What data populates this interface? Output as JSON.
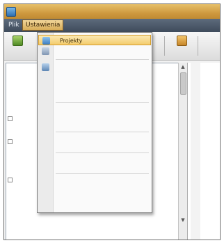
{
  "window": {
    "title": "",
    "title_hidden": ""
  },
  "menubar": {
    "items": [
      {
        "label": "Plik"
      },
      {
        "label": "Ustawienia"
      },
      {
        "label": ""
      },
      {
        "label": ""
      },
      {
        "label": ""
      },
      {
        "label": ""
      },
      {
        "label": ""
      }
    ],
    "active_index": 1
  },
  "toolbar": {
    "buttons": [
      {
        "label": "",
        "icon": "new-document-icon"
      },
      {
        "label": "",
        "icon": "tile-icon"
      }
    ]
  },
  "dropdown": {
    "items": [
      {
        "label": "Projekty",
        "icon": "projects-icon",
        "highlighted": true
      },
      {
        "label": "",
        "icon": "settings-icon"
      },
      {
        "label": "",
        "icon": "list-icon"
      },
      {
        "label": ""
      },
      {
        "label": ""
      },
      {
        "label": ""
      },
      {
        "label": ""
      },
      {
        "label": ""
      },
      {
        "label": ""
      },
      {
        "label": ""
      },
      {
        "label": ""
      },
      {
        "label": ""
      }
    ]
  },
  "tree": {
    "rows": [
      {
        "label": ""
      },
      {
        "label": ""
      },
      {
        "label": ""
      },
      {
        "label": ""
      },
      {
        "label": ""
      },
      {
        "label": ""
      },
      {
        "label": ""
      },
      {
        "label": ""
      },
      {
        "label": ""
      },
      {
        "label": ""
      },
      {
        "label": ""
      },
      {
        "label": ""
      },
      {
        "label": ""
      }
    ]
  },
  "colors": {
    "titlebar": "#cf9a40",
    "menubar": "#4b5767",
    "highlight": "#f4cc6d"
  }
}
